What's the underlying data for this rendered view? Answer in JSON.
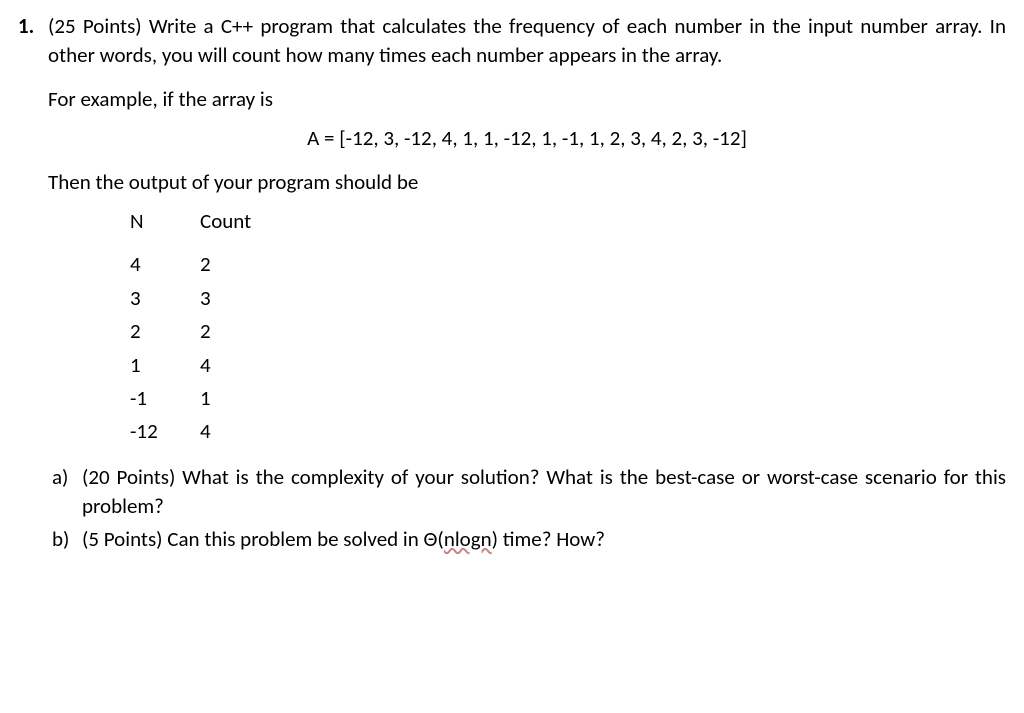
{
  "question": {
    "number": "1.",
    "points_prefix": "(25 Points) ",
    "text": "Write a C++ program that calculates the frequency of each number in the input number array. In other words, you will count how many times each number appears in the array.",
    "example_intro": "For example, if the array is",
    "array_display": "A = [-12, 3, -12, 4, 1, 1, -12, 1, -1, 1, 2, 3, 4, 2, 3, -12]",
    "output_intro": "Then the output of your program should be",
    "table": {
      "header_n": "N",
      "header_count": "Count",
      "rows": [
        {
          "n": "4",
          "count": "2"
        },
        {
          "n": "3",
          "count": "3"
        },
        {
          "n": "2",
          "count": "2"
        },
        {
          "n": "1",
          "count": "4"
        },
        {
          "n": "-1",
          "count": "1"
        },
        {
          "n": "-12",
          "count": "4"
        }
      ]
    },
    "subparts": {
      "a": {
        "marker": "a)",
        "text": "(20 Points) What is the complexity of your solution? What is the best-case or worst-case scenario for this problem?"
      },
      "b": {
        "marker": "b)",
        "prefix": "(5 Points) Can this problem be solved in ",
        "theta": "Θ(",
        "nlogn": "nlogn",
        "suffix": ") time? How?"
      }
    }
  }
}
